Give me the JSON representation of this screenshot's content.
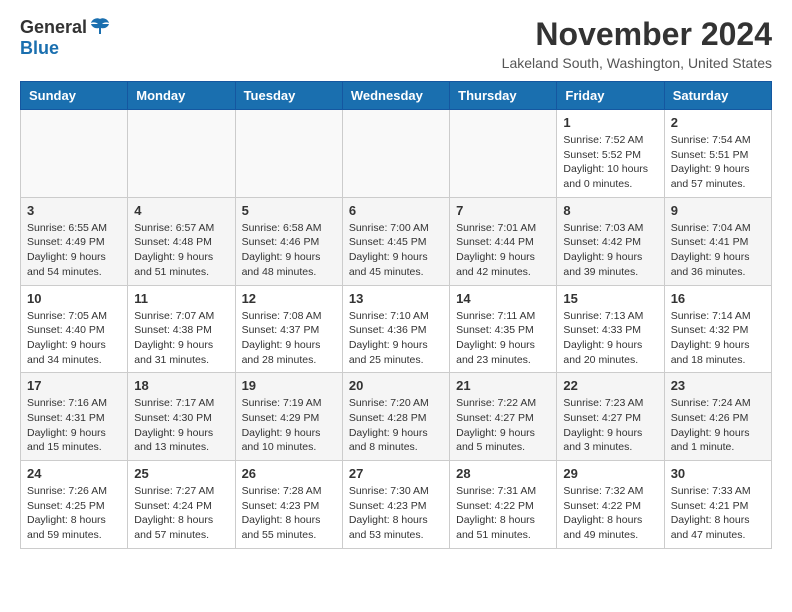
{
  "logo": {
    "general": "General",
    "blue": "Blue"
  },
  "title": "November 2024",
  "location": "Lakeland South, Washington, United States",
  "days_of_week": [
    "Sunday",
    "Monday",
    "Tuesday",
    "Wednesday",
    "Thursday",
    "Friday",
    "Saturday"
  ],
  "weeks": [
    [
      {
        "day": "",
        "detail": ""
      },
      {
        "day": "",
        "detail": ""
      },
      {
        "day": "",
        "detail": ""
      },
      {
        "day": "",
        "detail": ""
      },
      {
        "day": "",
        "detail": ""
      },
      {
        "day": "1",
        "detail": "Sunrise: 7:52 AM\nSunset: 5:52 PM\nDaylight: 10 hours\nand 0 minutes."
      },
      {
        "day": "2",
        "detail": "Sunrise: 7:54 AM\nSunset: 5:51 PM\nDaylight: 9 hours\nand 57 minutes."
      }
    ],
    [
      {
        "day": "3",
        "detail": "Sunrise: 6:55 AM\nSunset: 4:49 PM\nDaylight: 9 hours\nand 54 minutes."
      },
      {
        "day": "4",
        "detail": "Sunrise: 6:57 AM\nSunset: 4:48 PM\nDaylight: 9 hours\nand 51 minutes."
      },
      {
        "day": "5",
        "detail": "Sunrise: 6:58 AM\nSunset: 4:46 PM\nDaylight: 9 hours\nand 48 minutes."
      },
      {
        "day": "6",
        "detail": "Sunrise: 7:00 AM\nSunset: 4:45 PM\nDaylight: 9 hours\nand 45 minutes."
      },
      {
        "day": "7",
        "detail": "Sunrise: 7:01 AM\nSunset: 4:44 PM\nDaylight: 9 hours\nand 42 minutes."
      },
      {
        "day": "8",
        "detail": "Sunrise: 7:03 AM\nSunset: 4:42 PM\nDaylight: 9 hours\nand 39 minutes."
      },
      {
        "day": "9",
        "detail": "Sunrise: 7:04 AM\nSunset: 4:41 PM\nDaylight: 9 hours\nand 36 minutes."
      }
    ],
    [
      {
        "day": "10",
        "detail": "Sunrise: 7:05 AM\nSunset: 4:40 PM\nDaylight: 9 hours\nand 34 minutes."
      },
      {
        "day": "11",
        "detail": "Sunrise: 7:07 AM\nSunset: 4:38 PM\nDaylight: 9 hours\nand 31 minutes."
      },
      {
        "day": "12",
        "detail": "Sunrise: 7:08 AM\nSunset: 4:37 PM\nDaylight: 9 hours\nand 28 minutes."
      },
      {
        "day": "13",
        "detail": "Sunrise: 7:10 AM\nSunset: 4:36 PM\nDaylight: 9 hours\nand 25 minutes."
      },
      {
        "day": "14",
        "detail": "Sunrise: 7:11 AM\nSunset: 4:35 PM\nDaylight: 9 hours\nand 23 minutes."
      },
      {
        "day": "15",
        "detail": "Sunrise: 7:13 AM\nSunset: 4:33 PM\nDaylight: 9 hours\nand 20 minutes."
      },
      {
        "day": "16",
        "detail": "Sunrise: 7:14 AM\nSunset: 4:32 PM\nDaylight: 9 hours\nand 18 minutes."
      }
    ],
    [
      {
        "day": "17",
        "detail": "Sunrise: 7:16 AM\nSunset: 4:31 PM\nDaylight: 9 hours\nand 15 minutes."
      },
      {
        "day": "18",
        "detail": "Sunrise: 7:17 AM\nSunset: 4:30 PM\nDaylight: 9 hours\nand 13 minutes."
      },
      {
        "day": "19",
        "detail": "Sunrise: 7:19 AM\nSunset: 4:29 PM\nDaylight: 9 hours\nand 10 minutes."
      },
      {
        "day": "20",
        "detail": "Sunrise: 7:20 AM\nSunset: 4:28 PM\nDaylight: 9 hours\nand 8 minutes."
      },
      {
        "day": "21",
        "detail": "Sunrise: 7:22 AM\nSunset: 4:27 PM\nDaylight: 9 hours\nand 5 minutes."
      },
      {
        "day": "22",
        "detail": "Sunrise: 7:23 AM\nSunset: 4:27 PM\nDaylight: 9 hours\nand 3 minutes."
      },
      {
        "day": "23",
        "detail": "Sunrise: 7:24 AM\nSunset: 4:26 PM\nDaylight: 9 hours\nand 1 minute."
      }
    ],
    [
      {
        "day": "24",
        "detail": "Sunrise: 7:26 AM\nSunset: 4:25 PM\nDaylight: 8 hours\nand 59 minutes."
      },
      {
        "day": "25",
        "detail": "Sunrise: 7:27 AM\nSunset: 4:24 PM\nDaylight: 8 hours\nand 57 minutes."
      },
      {
        "day": "26",
        "detail": "Sunrise: 7:28 AM\nSunset: 4:23 PM\nDaylight: 8 hours\nand 55 minutes."
      },
      {
        "day": "27",
        "detail": "Sunrise: 7:30 AM\nSunset: 4:23 PM\nDaylight: 8 hours\nand 53 minutes."
      },
      {
        "day": "28",
        "detail": "Sunrise: 7:31 AM\nSunset: 4:22 PM\nDaylight: 8 hours\nand 51 minutes."
      },
      {
        "day": "29",
        "detail": "Sunrise: 7:32 AM\nSunset: 4:22 PM\nDaylight: 8 hours\nand 49 minutes."
      },
      {
        "day": "30",
        "detail": "Sunrise: 7:33 AM\nSunset: 4:21 PM\nDaylight: 8 hours\nand 47 minutes."
      }
    ]
  ]
}
